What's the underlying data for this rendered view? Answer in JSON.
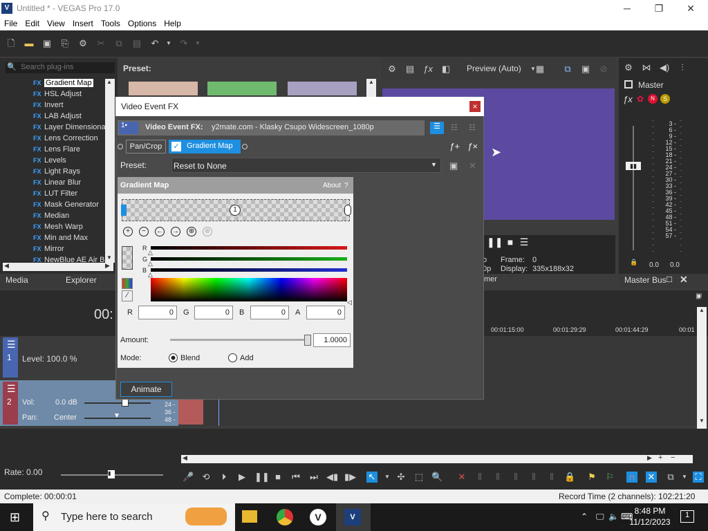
{
  "window": {
    "title": "Untitled * - VEGAS Pro 17.0",
    "minimize": "─",
    "maximize": "❐",
    "close": "✕"
  },
  "menu": [
    "File",
    "Edit",
    "View",
    "Insert",
    "Tools",
    "Options",
    "Help"
  ],
  "plugins": {
    "search_placeholder": "Search plug-ins",
    "preset_label": "Preset:",
    "items": [
      "Gradient Map",
      "HSL Adjust",
      "Invert",
      "LAB Adjust",
      "Layer Dimensional",
      "Lens Correction",
      "Lens Flare",
      "Levels",
      "Light Rays",
      "Linear Blur",
      "LUT Filter",
      "Mask Generator",
      "Median",
      "Mesh Warp",
      "Min and Max",
      "Mirror",
      "NewBlue AE Air Bc"
    ],
    "selected": "Gradient Map",
    "fx_tag": "FX"
  },
  "tabs": {
    "media": "Media",
    "explorer": "Explorer"
  },
  "preview": {
    "mode": "Preview (Auto)",
    "frame_label": "Frame:",
    "frame_value": "0",
    "display_label": "Display:",
    "display_value": "335x188x32",
    "left_frag_1": "o",
    "left_frag_2": "0p",
    "mixer_frag": "mer"
  },
  "master": {
    "label": "Master",
    "bus": "Master Bus",
    "db_ticks": [
      "3",
      "6",
      "9",
      "12",
      "15",
      "18",
      "21",
      "24",
      "27",
      "30",
      "33",
      "36",
      "39",
      "42",
      "45",
      "48",
      "51",
      "54",
      "57"
    ],
    "left_level": "0.0",
    "right_level": "0.0"
  },
  "timeline": {
    "timecode_frag": "00:",
    "ruler": [
      "00:01:15:00",
      "00:01:29:29",
      "00:01:44:29",
      "00:01"
    ],
    "track1": {
      "number": "1",
      "level": "Level: 100.0 %"
    },
    "track2": {
      "number": "2",
      "vol_label": "Vol:",
      "vol_value": "0.0 dB",
      "pan_label": "Pan:",
      "pan_value": "Center",
      "scale": [
        "24 -",
        "36 -",
        "48 -"
      ]
    }
  },
  "bottom": {
    "rate": "Rate: 0.00"
  },
  "status": {
    "complete": "Complete: 00:00:01",
    "record_time": "Record Time (2 channels): 102:21:20"
  },
  "taskbar": {
    "search": "Type here to search",
    "time": "8:48 PM",
    "date": "11/12/2023",
    "notif": "1"
  },
  "dialog": {
    "title": "Video Event FX",
    "close": "×",
    "header_label": "Video Event FX:",
    "header_source": "y2mate.com - Klasky Csupo Widescreen_1080p",
    "chain": [
      "Pan/Crop",
      "Gradient Map"
    ],
    "preset_label": "Preset:",
    "preset_value": "Reset to None",
    "animate": "Animate"
  },
  "gradient_map": {
    "title": "Gradient Map",
    "about": "About",
    "help": "?",
    "stop_number": "1",
    "rgb": [
      {
        "label": "R",
        "color": "#d81818"
      },
      {
        "label": "G",
        "color": "#19b019"
      },
      {
        "label": "B",
        "color": "#2030d0"
      }
    ],
    "fields": [
      {
        "label": "R",
        "value": "0"
      },
      {
        "label": "G",
        "value": "0"
      },
      {
        "label": "B",
        "value": "0"
      },
      {
        "label": "A",
        "value": "0"
      }
    ],
    "amount_label": "Amount:",
    "amount_value": "1.0000",
    "amount_fraction": 1.0,
    "mode_label": "Mode:",
    "mode_options": [
      "Blend",
      "Add"
    ],
    "mode_selected": "Blend"
  },
  "colors": {
    "accent": "#1e8fe0",
    "video_bg": "#5b4aa0",
    "track2_bg": "#6e8aa8",
    "dialog_bg": "#4a4a4a"
  }
}
